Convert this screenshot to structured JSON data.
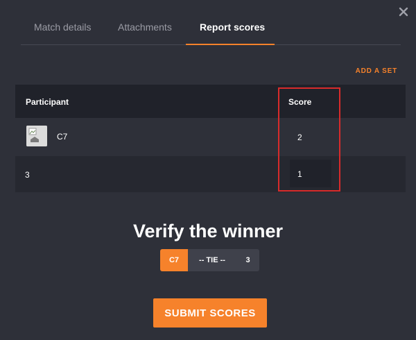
{
  "tabs": [
    {
      "label": "Match details"
    },
    {
      "label": "Attachments"
    },
    {
      "label": "Report scores"
    }
  ],
  "active_tab": "Report scores",
  "add_set_label": "ADD A SET",
  "table": {
    "headers": {
      "participant": "Participant",
      "score": "Score"
    },
    "rows": [
      {
        "participant": "C7",
        "score": "2",
        "has_avatar": true
      },
      {
        "participant": "3",
        "score": "1",
        "has_avatar": false
      }
    ]
  },
  "verify": {
    "title": "Verify the winner",
    "options": [
      "C7",
      "-- TIE --",
      "3"
    ],
    "selected": "C7"
  },
  "submit_label": "SUBMIT SCORES",
  "colors": {
    "accent": "#f6822b",
    "background": "#2e3039",
    "table_header": "#20222a",
    "highlight_box": "#d92b2b"
  },
  "icons": {
    "close": "close-icon",
    "avatar": "broken-image-icon"
  }
}
